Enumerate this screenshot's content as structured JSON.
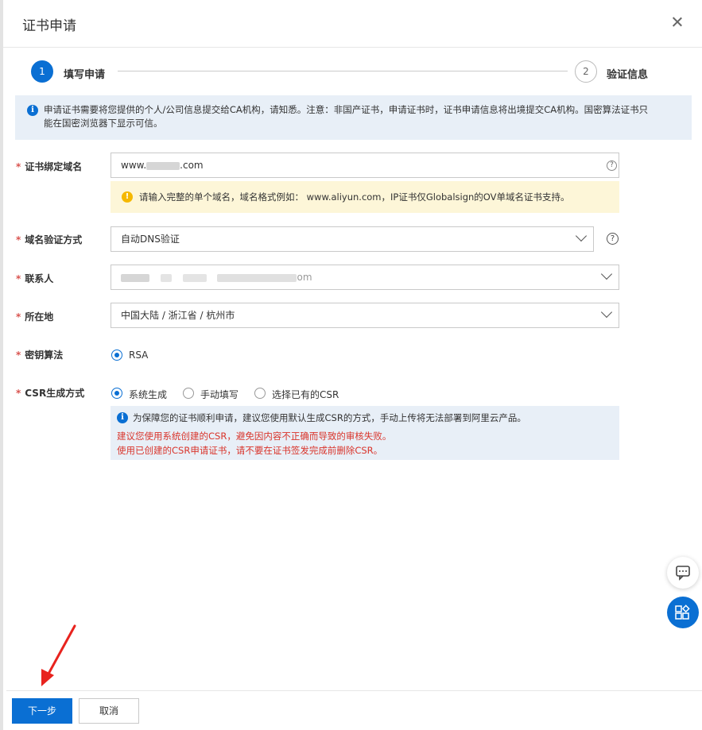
{
  "dialog": {
    "title": "证书申请"
  },
  "steps": [
    {
      "number": "1",
      "label": "填写申请"
    },
    {
      "number": "2",
      "label": "验证信息"
    }
  ],
  "notice": {
    "line1": "申请证书需要将您提供的个人/公司信息提交给CA机构，请知悉。注意：非国产证书，申请证书时，证书申请信息将出境提交CA机构。国密算法证书只",
    "line2": "能在国密浏览器下显示可信。"
  },
  "form": {
    "domain": {
      "label": "证书绑定域名",
      "value_prefix": "www.",
      "value_suffix": ".com",
      "hint": "请输入完整的单个域名，域名格式例如： www.aliyun.com，IP证书仅Globalsign的OV单域名证书支持。"
    },
    "verify_method": {
      "label": "域名验证方式",
      "value": "自动DNS验证"
    },
    "contact": {
      "label": "联系人",
      "value_fragment": "om"
    },
    "location": {
      "label": "所在地",
      "value": "中国大陆 / 浙江省 / 杭州市"
    },
    "key_algorithm": {
      "label": "密钥算法",
      "options": [
        "RSA"
      ],
      "selected": "RSA"
    },
    "csr_method": {
      "label": "CSR生成方式",
      "options": [
        "系统生成",
        "手动填写",
        "选择已有的CSR"
      ],
      "selected": "系统生成",
      "info": "为保障您的证书顺利申请，建议您使用默认生成CSR的方式，手动上传将无法部署到阿里云产品。",
      "warning1": "建议您使用系统创建的CSR，避免因内容不正确而导致的审核失败。",
      "warning2": "使用已创建的CSR申请证书，请不要在证书签发完成前删除CSR。"
    }
  },
  "required_mark": "*",
  "footer": {
    "next_label": "下一步",
    "cancel_label": "取消"
  },
  "colors": {
    "primary": "#0a6fd3",
    "required": "#d9534f",
    "warning_bg": "#fdf6d8",
    "info_bg": "#e8eff7",
    "error_text": "#d9342b",
    "annotation_arrow": "#e8231e"
  },
  "icons": {
    "close": "close-icon",
    "info": "info-icon",
    "warning": "warning-icon",
    "help": "question-icon",
    "chat": "chat-icon",
    "apps": "apps-icon"
  }
}
